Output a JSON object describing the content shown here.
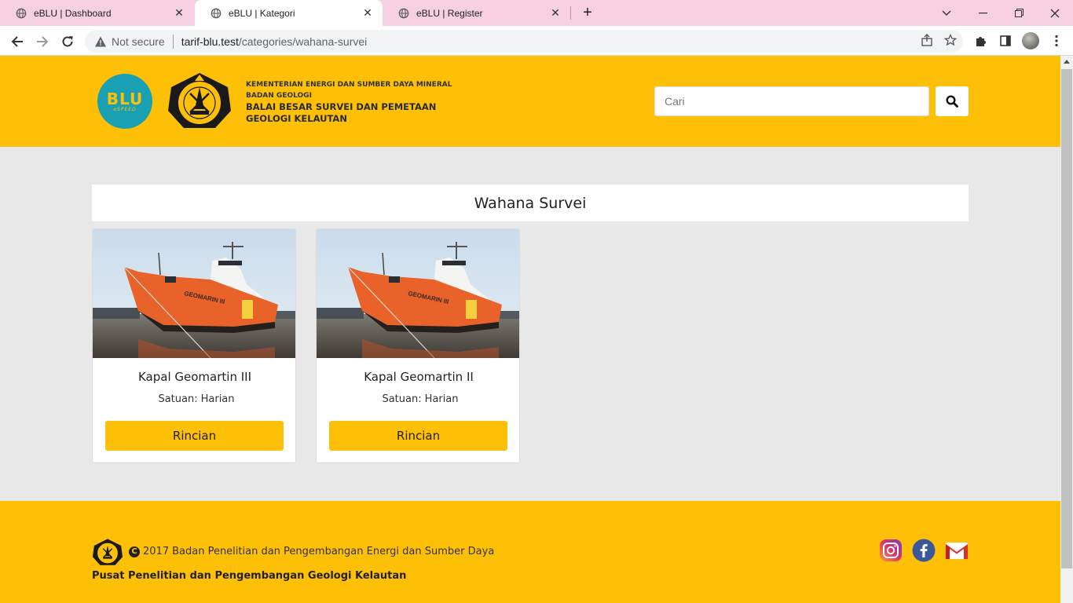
{
  "browser": {
    "tabs": [
      {
        "title": "eBLU | Dashboard"
      },
      {
        "title": "eBLU | Kategori"
      },
      {
        "title": "eBLU | Register"
      }
    ],
    "address": {
      "security_label": "Not secure",
      "url_host": "tarif-blu.test",
      "url_path": "/categories/wahana-survei"
    }
  },
  "header": {
    "logo_text": "BLU",
    "logo_sub": "eSPEED",
    "ministry": "KEMENTERIAN ENERGI DAN SUMBER DAYA MINERAL",
    "agency": "BADAN GEOLOGI",
    "office_line1": "BALAI BESAR SURVEI DAN PEMETAAN",
    "office_line2": "GEOLOGI KELAUTAN",
    "search_placeholder": "Cari"
  },
  "category": {
    "title": "Wahana Survei"
  },
  "products": [
    {
      "name": "Kapal Geomartin III",
      "unit_label": "Satuan:",
      "unit_value": "Harian",
      "button": "Rincian",
      "ship_label": "GEOMARIN III"
    },
    {
      "name": "Kapal Geomartin II",
      "unit_label": "Satuan:",
      "unit_value": "Harian",
      "button": "Rincian",
      "ship_label": "GEOMARIN III"
    }
  ],
  "footer": {
    "copyright_year": "2017",
    "copyright_text": "Badan Penelitian dan Pengembangan Energi dan Sumber Daya",
    "center_name": "Pusat Penelitian dan Pengembangan Geologi Kelautan",
    "social": [
      "instagram-icon",
      "facebook-icon",
      "gmail-icon"
    ]
  },
  "colors": {
    "brand_yellow": "#fec007",
    "blu_teal": "#1aa0b3",
    "tab_bar_pink": "#f6cfe0"
  }
}
